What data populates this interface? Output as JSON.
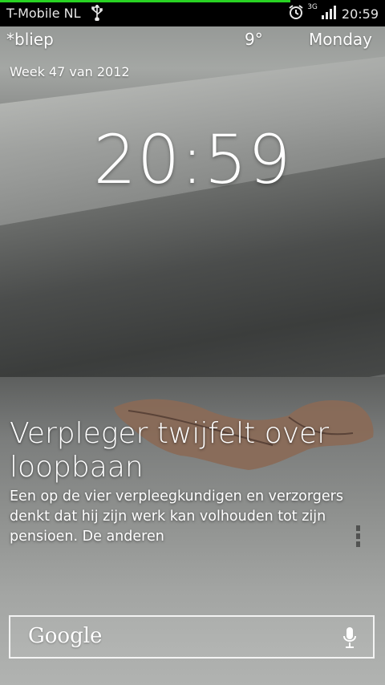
{
  "status_bar": {
    "carrier": "T-Mobile NL",
    "time": "20:59",
    "network_type": "3G",
    "icons": [
      "usb-icon",
      "alarm-icon",
      "3g-icon",
      "signal-icon"
    ],
    "progress_fraction": 0.755,
    "progress_color": "#29d323"
  },
  "widgets": {
    "location": "*bliep",
    "temperature": "9°",
    "day": "Monday",
    "week": "Week 47 van 2012",
    "clock": "20:59"
  },
  "news": {
    "title": "Verpleger twijfelt over loopbaan",
    "body": "Een op de vier verpleegkundigen en verzorgers denkt dat hij zijn werk kan volhouden tot zijn pensioen. De anderen"
  },
  "search": {
    "label": "Google",
    "icon": "microphone-icon"
  }
}
